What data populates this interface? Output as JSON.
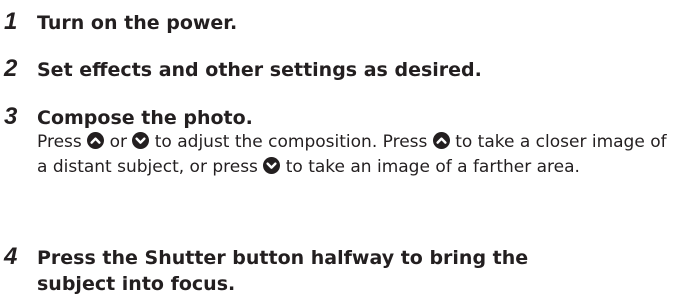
{
  "steps": [
    {
      "number": "1",
      "title": "Turn on the power."
    },
    {
      "number": "2",
      "title": "Set effects and other settings as desired."
    },
    {
      "number": "3",
      "title": "Compose the photo.",
      "body": {
        "t1": "Press",
        "t2": "or",
        "t3": "to adjust the composition. Press",
        "t4": "to take a closer image of a distant subject, or press",
        "t5": "to take an image of a farther area."
      }
    },
    {
      "number": "4",
      "title_line1": "Press the Shutter button halfway to bring the",
      "title_line2": "subject into focus."
    }
  ],
  "icons": [
    "up-button-icon",
    "down-button-icon"
  ]
}
